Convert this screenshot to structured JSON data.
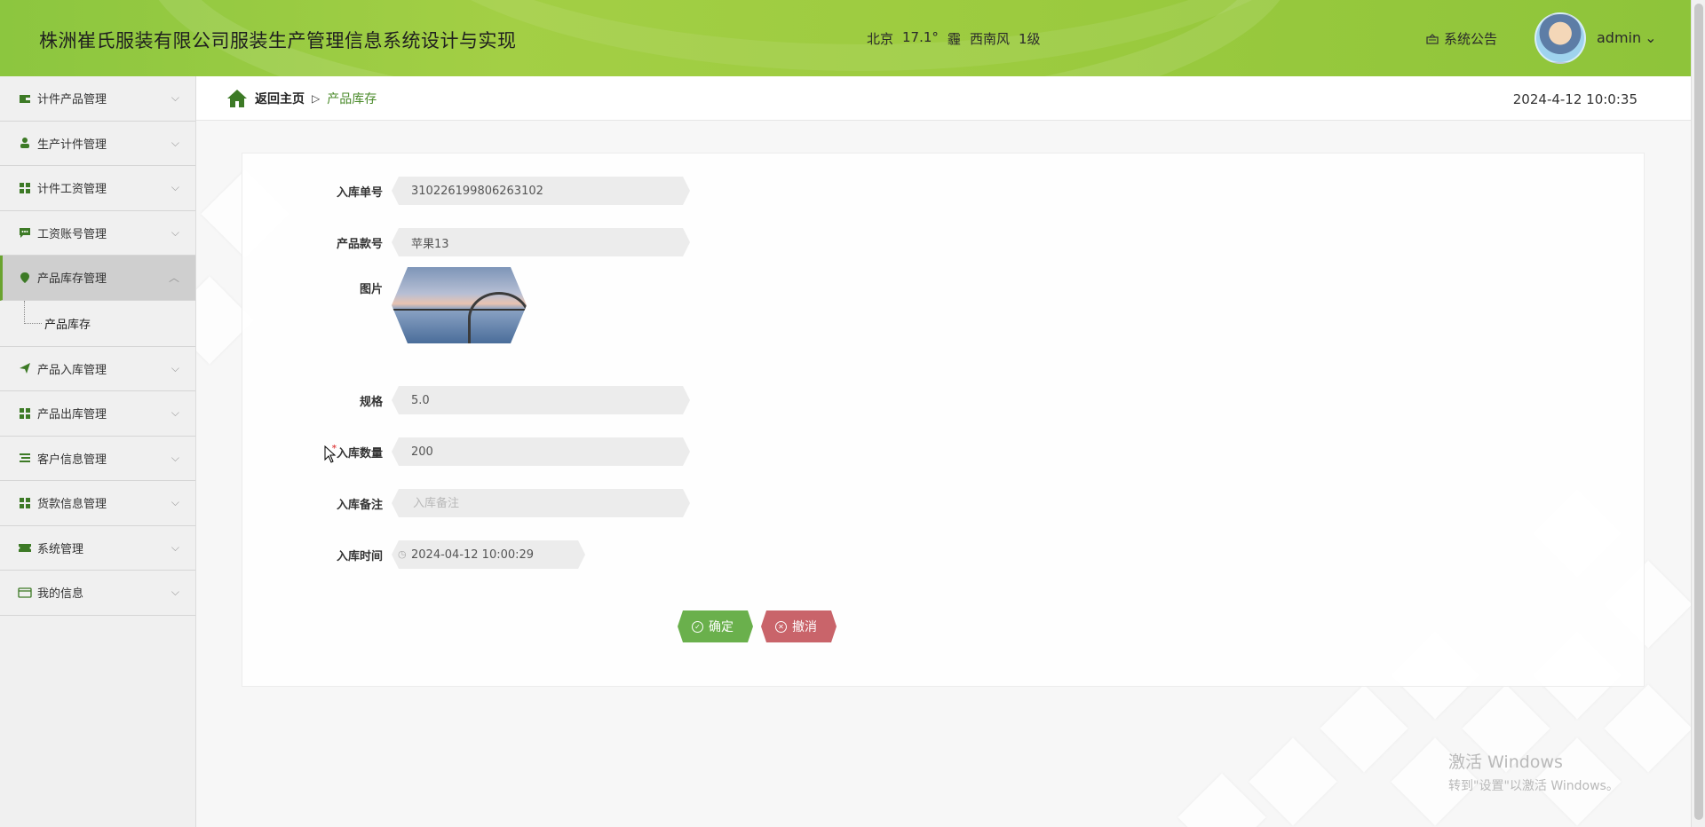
{
  "header": {
    "title": "株洲崔氏服装有限公司服装生产管理信息系统设计与实现",
    "weather": {
      "city": "北京",
      "temp": "17.1°",
      "condition": "霾",
      "wind": "西南风",
      "level": "1级"
    },
    "notice_label": "系统公告",
    "username": "admin",
    "chevron": "⌄"
  },
  "sidebar": {
    "items": [
      {
        "label": "计件产品管理",
        "icon": "wallet-icon"
      },
      {
        "label": "生产计件管理",
        "icon": "user-icon"
      },
      {
        "label": "计件工资管理",
        "icon": "grid-icon"
      },
      {
        "label": "工资账号管理",
        "icon": "chat-icon"
      },
      {
        "label": "产品库存管理",
        "icon": "location-icon"
      },
      {
        "label": "产品入库管理",
        "icon": "paper-plane-icon"
      },
      {
        "label": "产品出库管理",
        "icon": "grid-icon"
      },
      {
        "label": "客户信息管理",
        "icon": "list-icon"
      },
      {
        "label": "货款信息管理",
        "icon": "grid-icon"
      },
      {
        "label": "系统管理",
        "icon": "ticket-icon"
      },
      {
        "label": "我的信息",
        "icon": "card-icon"
      }
    ],
    "submenu_label": "产品库存"
  },
  "breadcrumb": {
    "home": "返回主页",
    "separator": "▷",
    "current": "产品库存"
  },
  "datetime": "2024-4-12 10:0:35",
  "form": {
    "order_no": {
      "label": "入库单号",
      "value": "310226199806263102"
    },
    "product_code": {
      "label": "产品款号",
      "value": "苹果13"
    },
    "image": {
      "label": "图片"
    },
    "spec": {
      "label": "规格",
      "value": "5.0"
    },
    "quantity": {
      "label": "入库数量",
      "value": "200",
      "required_mark": "*"
    },
    "remark": {
      "label": "入库备注",
      "value": "",
      "placeholder": "入库备注"
    },
    "time": {
      "label": "入库时间",
      "value": "2024-04-12 10:00:29"
    }
  },
  "buttons": {
    "confirm": "确定",
    "cancel": "撤消"
  },
  "watermark": {
    "line1": "激活 Windows",
    "line2": "转到\"设置\"以激活 Windows。"
  },
  "colors": {
    "header_green": "#9ccb3f",
    "accent_green": "#4a8a2a",
    "confirm_button": "#6ab04c",
    "cancel_button": "#c9646a"
  }
}
